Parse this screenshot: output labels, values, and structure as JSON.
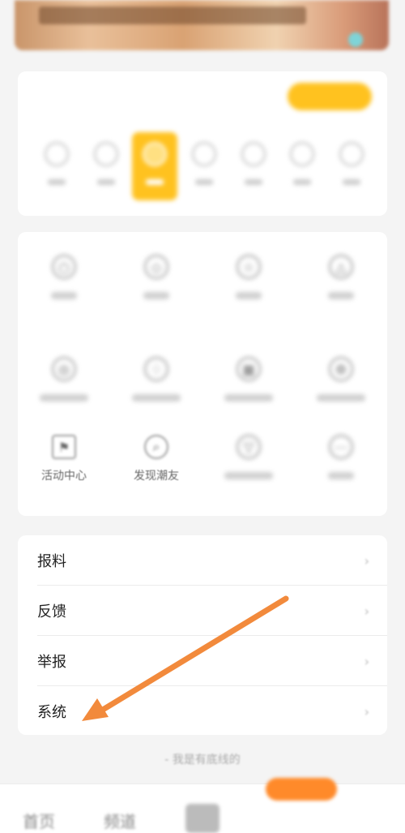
{
  "banner": {
    "label": ""
  },
  "checkin": {
    "title": "",
    "button_label": "",
    "days": [
      {
        "label": "",
        "active": false
      },
      {
        "label": "",
        "active": false
      },
      {
        "label": "",
        "active": true
      },
      {
        "label": "",
        "active": false
      },
      {
        "label": "",
        "active": false
      },
      {
        "label": "",
        "active": false
      },
      {
        "label": "",
        "active": false
      }
    ]
  },
  "shortcuts": {
    "activity_center_label": "活动中心",
    "discover_friends_label": "发现潮友"
  },
  "menu": {
    "items": [
      {
        "label": "报料"
      },
      {
        "label": "反馈"
      },
      {
        "label": "举报"
      },
      {
        "label": "系统"
      }
    ]
  },
  "footer": {
    "end_text": "- 我是有底线的"
  },
  "tabbar": {
    "home_label": "首页",
    "channel_label": "频道",
    "tab4_label": "",
    "mine_label": ""
  },
  "colors": {
    "accent": "#ffc21f",
    "arrow": "#f28a3c"
  }
}
